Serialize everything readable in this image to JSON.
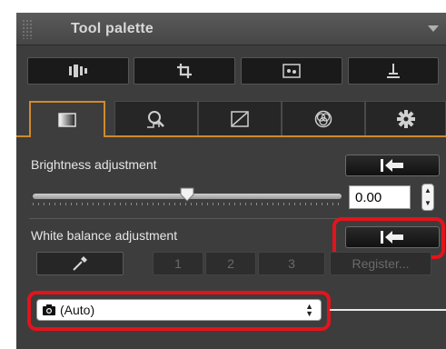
{
  "palette": {
    "title": "Tool palette"
  },
  "brightness": {
    "label": "Brightness adjustment",
    "value": "0.00",
    "slider_level": 0.5
  },
  "white_balance": {
    "label": "White balance adjustment",
    "buttons": [
      "1",
      "2",
      "3",
      "Register..."
    ],
    "selected": "(Auto)"
  },
  "colors": {
    "accent_tab": "#d08a2c",
    "highlight_ring": "#e3141b",
    "panel_bg": "#3d3d3d"
  },
  "icons": {
    "top_row": [
      "rgb-image-icon",
      "crop-icon",
      "dust-delete-icon",
      "level-icon"
    ],
    "tabs": [
      "basic-adjust-tab-icon",
      "detail-tab-icon",
      "tone-curve-tab-icon",
      "color-tab-icon",
      "settings-tab-icon"
    ]
  }
}
